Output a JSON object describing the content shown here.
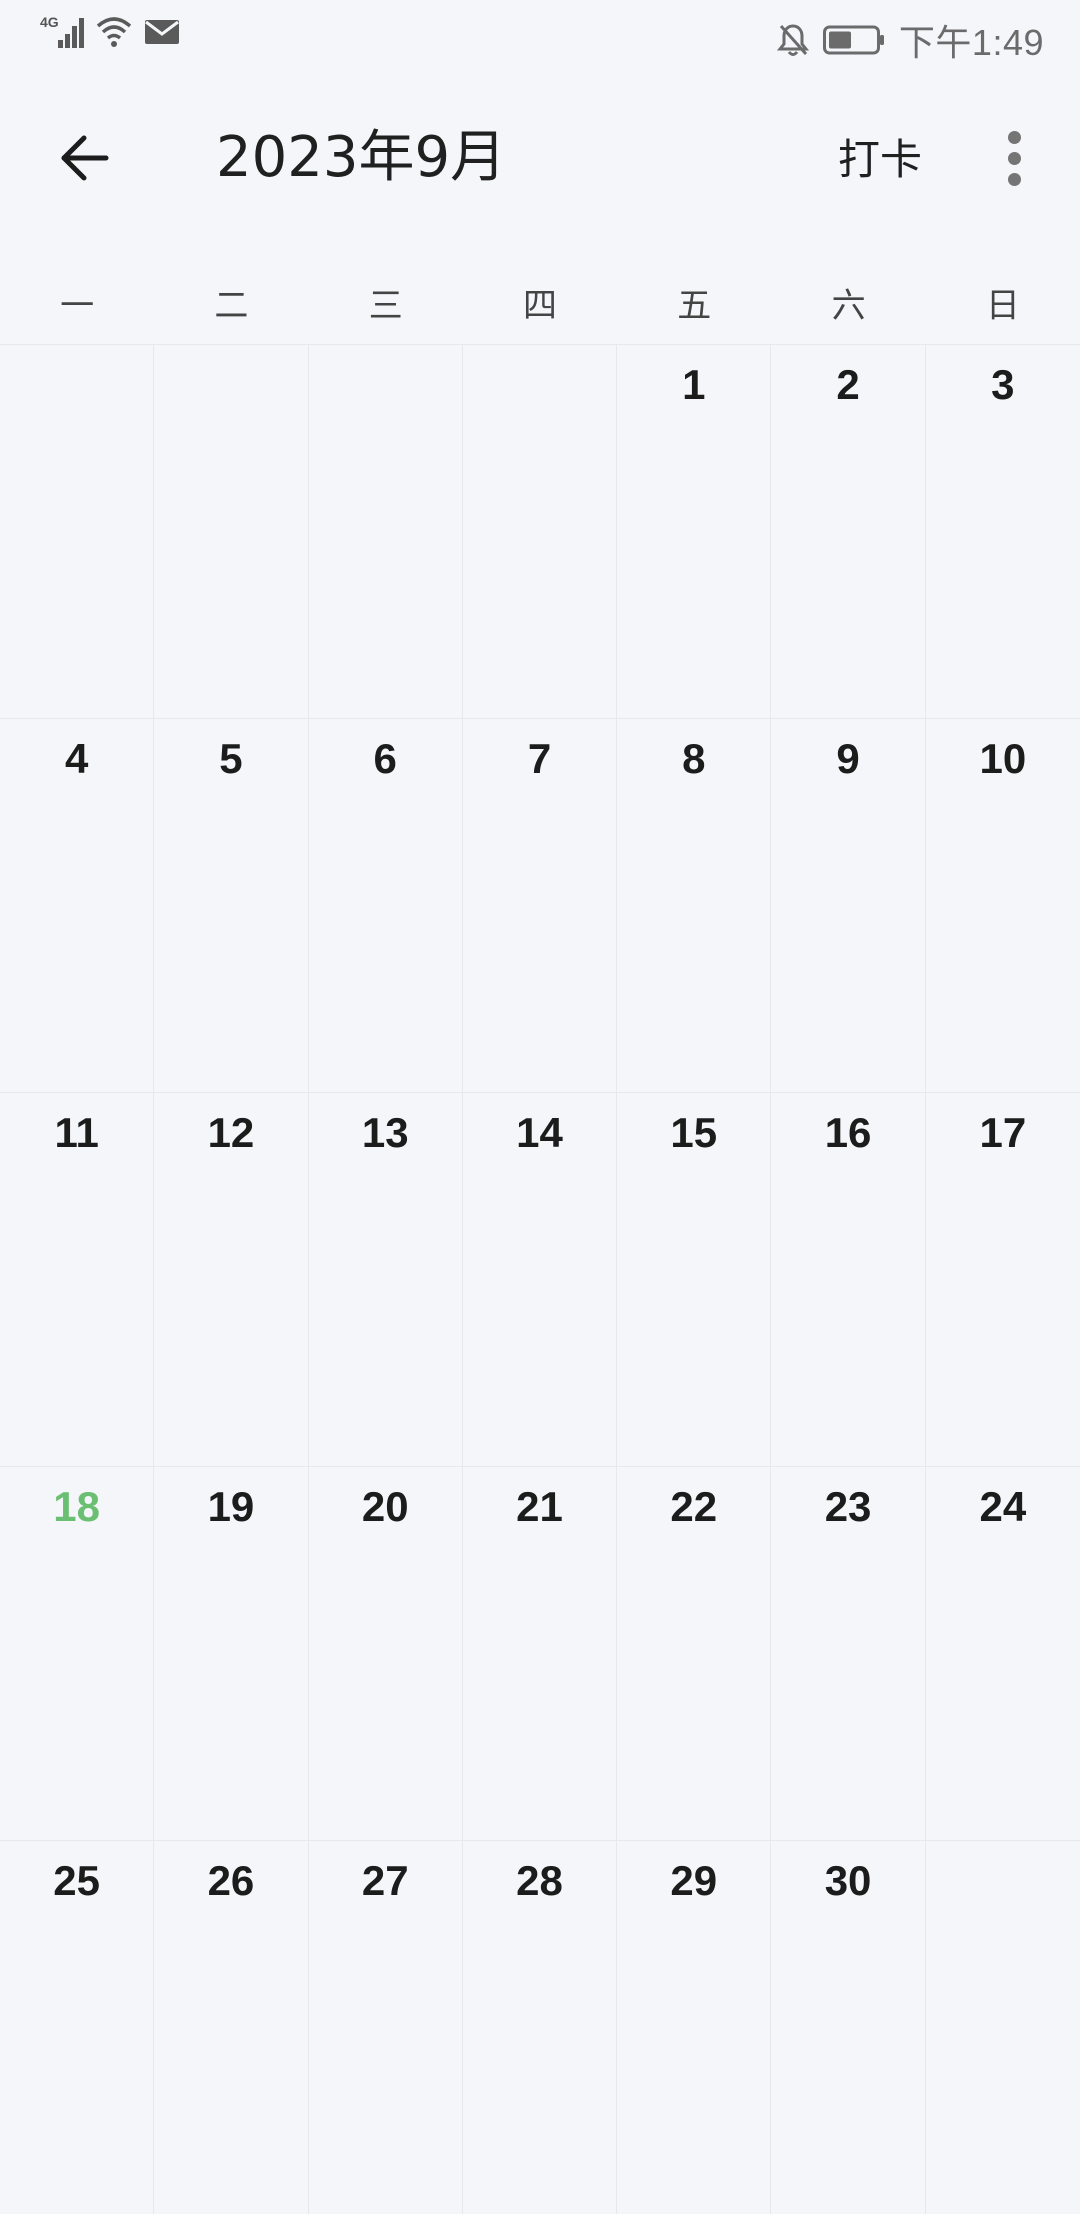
{
  "status_bar": {
    "network_label": "4G",
    "time": "下午1:49",
    "icons": [
      "signal-icon",
      "wifi-icon",
      "mail-icon",
      "bell-muted-icon",
      "battery-icon"
    ]
  },
  "appbar": {
    "back_icon": "arrow-left-icon",
    "title": "2023年9月",
    "checkin_label": "打卡",
    "more_icon": "more-vertical-icon"
  },
  "weekdays": [
    "一",
    "二",
    "三",
    "四",
    "五",
    "六",
    "日"
  ],
  "calendar": {
    "cells": [
      "",
      "",
      "",
      "",
      "1",
      "2",
      "3",
      "4",
      "5",
      "6",
      "7",
      "8",
      "9",
      "10",
      "11",
      "12",
      "13",
      "14",
      "15",
      "16",
      "17",
      "18",
      "19",
      "20",
      "21",
      "22",
      "23",
      "24",
      "25",
      "26",
      "27",
      "28",
      "29",
      "30",
      ""
    ],
    "today": "18",
    "today_color": "#6bbf72"
  }
}
